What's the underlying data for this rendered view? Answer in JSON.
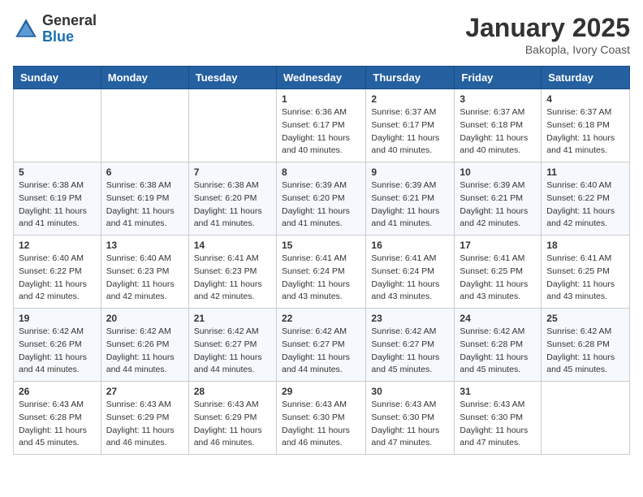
{
  "header": {
    "logo_general": "General",
    "logo_blue": "Blue",
    "month_title": "January 2025",
    "location": "Bakopla, Ivory Coast"
  },
  "days_of_week": [
    "Sunday",
    "Monday",
    "Tuesday",
    "Wednesday",
    "Thursday",
    "Friday",
    "Saturday"
  ],
  "weeks": [
    [
      {
        "day": "",
        "info": ""
      },
      {
        "day": "",
        "info": ""
      },
      {
        "day": "",
        "info": ""
      },
      {
        "day": "1",
        "info": "Sunrise: 6:36 AM\nSunset: 6:17 PM\nDaylight: 11 hours and 40 minutes."
      },
      {
        "day": "2",
        "info": "Sunrise: 6:37 AM\nSunset: 6:17 PM\nDaylight: 11 hours and 40 minutes."
      },
      {
        "day": "3",
        "info": "Sunrise: 6:37 AM\nSunset: 6:18 PM\nDaylight: 11 hours and 40 minutes."
      },
      {
        "day": "4",
        "info": "Sunrise: 6:37 AM\nSunset: 6:18 PM\nDaylight: 11 hours and 41 minutes."
      }
    ],
    [
      {
        "day": "5",
        "info": "Sunrise: 6:38 AM\nSunset: 6:19 PM\nDaylight: 11 hours and 41 minutes."
      },
      {
        "day": "6",
        "info": "Sunrise: 6:38 AM\nSunset: 6:19 PM\nDaylight: 11 hours and 41 minutes."
      },
      {
        "day": "7",
        "info": "Sunrise: 6:38 AM\nSunset: 6:20 PM\nDaylight: 11 hours and 41 minutes."
      },
      {
        "day": "8",
        "info": "Sunrise: 6:39 AM\nSunset: 6:20 PM\nDaylight: 11 hours and 41 minutes."
      },
      {
        "day": "9",
        "info": "Sunrise: 6:39 AM\nSunset: 6:21 PM\nDaylight: 11 hours and 41 minutes."
      },
      {
        "day": "10",
        "info": "Sunrise: 6:39 AM\nSunset: 6:21 PM\nDaylight: 11 hours and 42 minutes."
      },
      {
        "day": "11",
        "info": "Sunrise: 6:40 AM\nSunset: 6:22 PM\nDaylight: 11 hours and 42 minutes."
      }
    ],
    [
      {
        "day": "12",
        "info": "Sunrise: 6:40 AM\nSunset: 6:22 PM\nDaylight: 11 hours and 42 minutes."
      },
      {
        "day": "13",
        "info": "Sunrise: 6:40 AM\nSunset: 6:23 PM\nDaylight: 11 hours and 42 minutes."
      },
      {
        "day": "14",
        "info": "Sunrise: 6:41 AM\nSunset: 6:23 PM\nDaylight: 11 hours and 42 minutes."
      },
      {
        "day": "15",
        "info": "Sunrise: 6:41 AM\nSunset: 6:24 PM\nDaylight: 11 hours and 43 minutes."
      },
      {
        "day": "16",
        "info": "Sunrise: 6:41 AM\nSunset: 6:24 PM\nDaylight: 11 hours and 43 minutes."
      },
      {
        "day": "17",
        "info": "Sunrise: 6:41 AM\nSunset: 6:25 PM\nDaylight: 11 hours and 43 minutes."
      },
      {
        "day": "18",
        "info": "Sunrise: 6:41 AM\nSunset: 6:25 PM\nDaylight: 11 hours and 43 minutes."
      }
    ],
    [
      {
        "day": "19",
        "info": "Sunrise: 6:42 AM\nSunset: 6:26 PM\nDaylight: 11 hours and 44 minutes."
      },
      {
        "day": "20",
        "info": "Sunrise: 6:42 AM\nSunset: 6:26 PM\nDaylight: 11 hours and 44 minutes."
      },
      {
        "day": "21",
        "info": "Sunrise: 6:42 AM\nSunset: 6:27 PM\nDaylight: 11 hours and 44 minutes."
      },
      {
        "day": "22",
        "info": "Sunrise: 6:42 AM\nSunset: 6:27 PM\nDaylight: 11 hours and 44 minutes."
      },
      {
        "day": "23",
        "info": "Sunrise: 6:42 AM\nSunset: 6:27 PM\nDaylight: 11 hours and 45 minutes."
      },
      {
        "day": "24",
        "info": "Sunrise: 6:42 AM\nSunset: 6:28 PM\nDaylight: 11 hours and 45 minutes."
      },
      {
        "day": "25",
        "info": "Sunrise: 6:42 AM\nSunset: 6:28 PM\nDaylight: 11 hours and 45 minutes."
      }
    ],
    [
      {
        "day": "26",
        "info": "Sunrise: 6:43 AM\nSunset: 6:28 PM\nDaylight: 11 hours and 45 minutes."
      },
      {
        "day": "27",
        "info": "Sunrise: 6:43 AM\nSunset: 6:29 PM\nDaylight: 11 hours and 46 minutes."
      },
      {
        "day": "28",
        "info": "Sunrise: 6:43 AM\nSunset: 6:29 PM\nDaylight: 11 hours and 46 minutes."
      },
      {
        "day": "29",
        "info": "Sunrise: 6:43 AM\nSunset: 6:30 PM\nDaylight: 11 hours and 46 minutes."
      },
      {
        "day": "30",
        "info": "Sunrise: 6:43 AM\nSunset: 6:30 PM\nDaylight: 11 hours and 47 minutes."
      },
      {
        "day": "31",
        "info": "Sunrise: 6:43 AM\nSunset: 6:30 PM\nDaylight: 11 hours and 47 minutes."
      },
      {
        "day": "",
        "info": ""
      }
    ]
  ]
}
